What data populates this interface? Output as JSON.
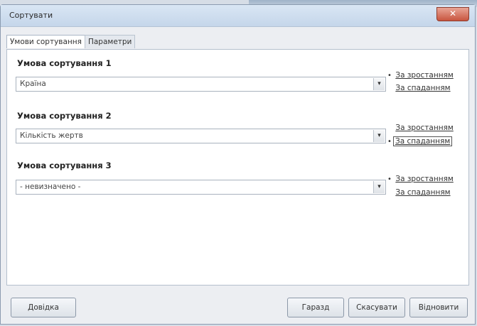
{
  "window": {
    "title": "Сортувати",
    "close_glyph": "✕"
  },
  "tabs": [
    {
      "label": "Умови сортування"
    },
    {
      "label": "Параметри"
    }
  ],
  "conditions": [
    {
      "title": "Умова сортування  1",
      "value": "Країна",
      "asc": "За зростанням",
      "desc": "За спаданням",
      "selected": "asc"
    },
    {
      "title": "Умова сортування  2",
      "value": "Кількість жертв",
      "asc": "За зростанням",
      "desc": "За спаданням",
      "selected": "desc"
    },
    {
      "title": "Умова сортування  3",
      "value": "- невизначено -",
      "asc": "За зростанням",
      "desc": "За спаданням",
      "selected": "asc"
    }
  ],
  "buttons": {
    "help": "Довідка",
    "ok": "Гаразд",
    "cancel": "Скасувати",
    "reset": "Відновити"
  },
  "dropdown_glyph": "▾",
  "radio_dot": "•"
}
